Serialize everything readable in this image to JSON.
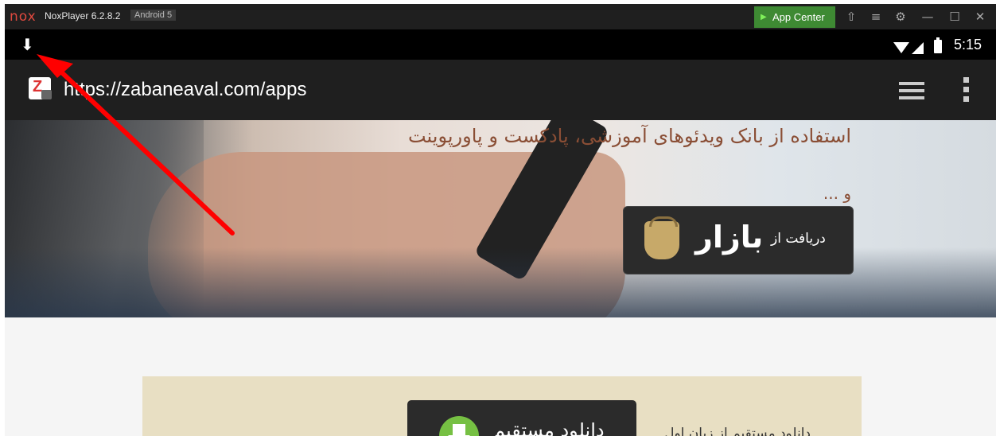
{
  "window": {
    "app_title": "NoxPlayer 6.2.8.2",
    "android_badge": "Android 5",
    "app_center_label": "App Center",
    "logo_text": "nox",
    "controls": [
      "keyboard-icon",
      "menu-lines-icon",
      "gear-icon",
      "minimize-icon",
      "maximize-icon",
      "close-icon"
    ]
  },
  "status_bar": {
    "time": "5:15",
    "icons": [
      "download-icon",
      "wifi-icon",
      "signal-icon",
      "battery-icon"
    ]
  },
  "browser": {
    "url": "https://zabaneaval.com/apps",
    "site_icon_letter": "Z"
  },
  "hero": {
    "line1": "استفاده از بانک ویدئوهای آموزشی، پادکست و پاورپوینت",
    "line2": "و ...",
    "bazaar_get_label": "دریافت از",
    "bazaar_logo": "بازار"
  },
  "banner": {
    "text": "دانلود مستقیم از زبان اول",
    "direct_download_label": "دانلود مستقیم"
  },
  "annotation": {
    "arrow_color": "#ff0000"
  }
}
